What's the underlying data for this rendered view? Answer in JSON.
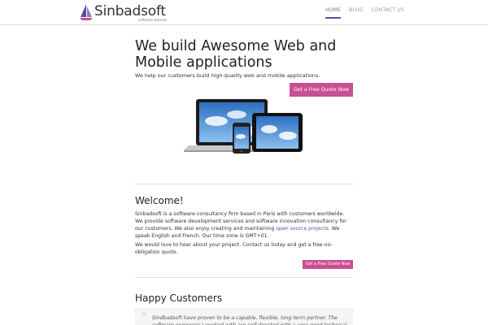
{
  "brand": {
    "name": "Sinbadsoft",
    "tagline": "software wizards",
    "sail_color": "#5b4fa0",
    "sail_accent": "#c94f92"
  },
  "nav": {
    "items": [
      {
        "label": "HOME",
        "active": true
      },
      {
        "label": "BLOG",
        "active": false
      },
      {
        "label": "CONTACT US",
        "active": false
      }
    ]
  },
  "hero": {
    "title": "We build Awesome Web and Mobile applications",
    "subtitle": "We help our customers build high-quality web and mobile applications.",
    "cta_label": "Get a Free Quote Now"
  },
  "welcome": {
    "title": "Welcome!",
    "paragraph1_before_link": "Sinbadsoft is a software consultancy firm based in Paris with customers worldwide. We provide software development services and software innovation consultancy for our customers. We also enjoy creating and maintaining ",
    "paragraph1_link": "open source projects",
    "paragraph1_after_link": ". We speak English and French. Our time zone is GMT+01.",
    "paragraph2": "We would love to hear about your project. Contact us today and get a free no-obligation quote.",
    "cta_label": "Get a Free Quote Now"
  },
  "customers": {
    "title": "Happy Customers",
    "quote_mark": "“",
    "quote": "Sindbadsoft have proven to be a capable, flexible, long term partner. The software engineers I worked with are self directed with a very good technical"
  },
  "colors": {
    "accent_purple": "#5b4fa0",
    "button_pink": "#c94f92"
  },
  "icons": {
    "logo": "sailboat-icon",
    "devices": "devices-illustration"
  }
}
